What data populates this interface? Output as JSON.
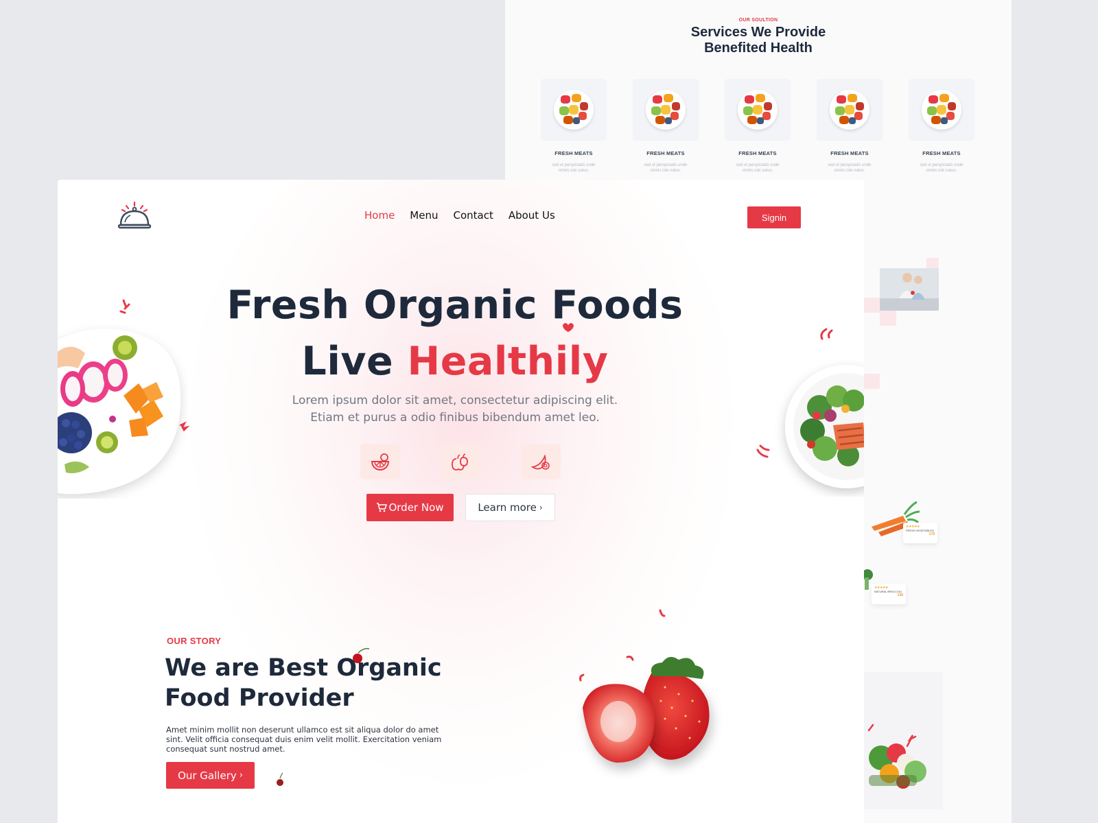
{
  "services": {
    "kicker": "OUR SOULTION",
    "title_line1": "Services We Provide",
    "title_line2": "Benefited Health",
    "cards": [
      {
        "name": "FRESH MEATS",
        "desc": "sed ut perspiciatis unde omnis iste natus."
      },
      {
        "name": "FRESH MEATS",
        "desc": "sed ut perspiciatis unde omnis iste natus."
      },
      {
        "name": "FRESH MEATS",
        "desc": "sed ut perspiciatis unde omnis iste natus."
      },
      {
        "name": "FRESH MEATS",
        "desc": "sed ut perspiciatis unde omnis iste natus."
      },
      {
        "name": "FRESH MEATS",
        "desc": "sed ut perspiciatis unde omnis iste natus."
      }
    ],
    "products": [
      {
        "stars": "★★★★★",
        "name": "FRESH VEGETABLES",
        "price": "17$"
      },
      {
        "stars": "★★★★★",
        "name": "NATURAL BROCCOLI",
        "price": "19$"
      }
    ]
  },
  "nav": {
    "items": [
      "Home",
      "Menu",
      "Contact",
      "About Us"
    ],
    "active": "Home",
    "signin": "Signin"
  },
  "hero": {
    "title_line1": "Fresh Organic Foods",
    "title_line2_prefix": "Live ",
    "title_line2_accent": "Healthily",
    "subtitle_line1": "Lorem ipsum dolor sit amet, consectetur adipiscing elit.",
    "subtitle_line2": "Etiam et purus a odio finibus bibendum amet leo.",
    "feature_icons": [
      "orange-slice-icon",
      "apple-icon",
      "banana-icon"
    ],
    "order_label": "Order Now",
    "learn_label": "Learn more"
  },
  "story": {
    "kicker": "OUR STORY",
    "title_line1": "We are Best Organic",
    "title_line2": "Food Provider",
    "body": "Amet minim mollit non deserunt ullamco est sit aliqua dolor do amet sint. Velit officia consequat duis enim velit mollit. Exercitation veniam consequat sunt nostrud amet.",
    "gallery_label": "Our Gallery"
  },
  "colors": {
    "accent": "#e63946",
    "heading": "#1e2a3b",
    "background": "#e8e9ed"
  }
}
